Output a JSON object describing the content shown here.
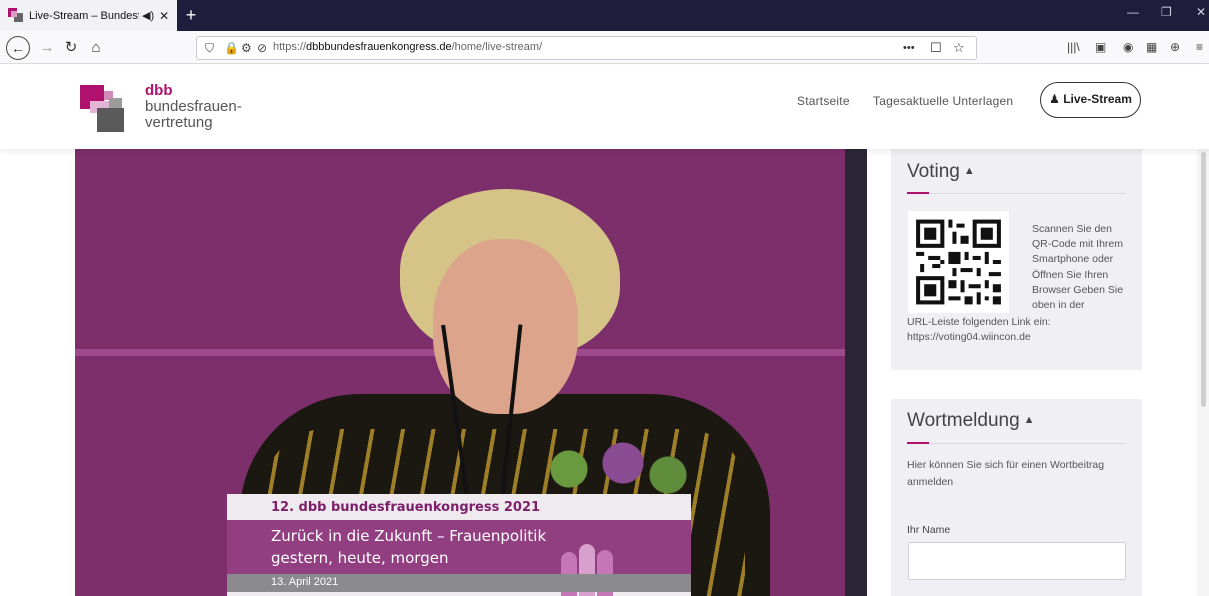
{
  "browser": {
    "tab_title": "Live-Stream – Bundesfrauen",
    "tab_audio_icon": "speaker-icon",
    "tab_close": "✕",
    "new_tab": "+",
    "url_prefix": "https://",
    "url_domain": "dbbbundesfrauenkongress.de",
    "url_path": "/home/live-stream/",
    "url_more": "•••"
  },
  "site": {
    "logo_line1": "dbb",
    "logo_line2": "bundesfrauen-",
    "logo_line3": "vertretung",
    "brand_color": "#b0106e",
    "menu": {
      "home": "Startseite",
      "docs": "Tagesaktuelle Unterlagen",
      "live": "Live-Stream"
    }
  },
  "video": {
    "banner_top": "12. dbb bundesfrauenkongress 2021",
    "banner_title1": "Zurück in die Zukunft – Frauenpolitik",
    "banner_title2": "gestern, heute, morgen",
    "banner_date": "13. April 2021"
  },
  "voting": {
    "heading": "Voting",
    "text_side": "Scannen Sie den QR-Code mit Ihrem Smartphone oder Öffnen Sie Ihren Browser Geben Sie oben in der",
    "text_bottom": "URL-Leiste folgenden Link ein: https://voting04.wiincon.de"
  },
  "wortmeldung": {
    "heading": "Wortmeldung",
    "text": "Hier können Sie sich für einen Wortbeitrag anmelden",
    "name_label": "Ihr Name",
    "name_value": ""
  }
}
